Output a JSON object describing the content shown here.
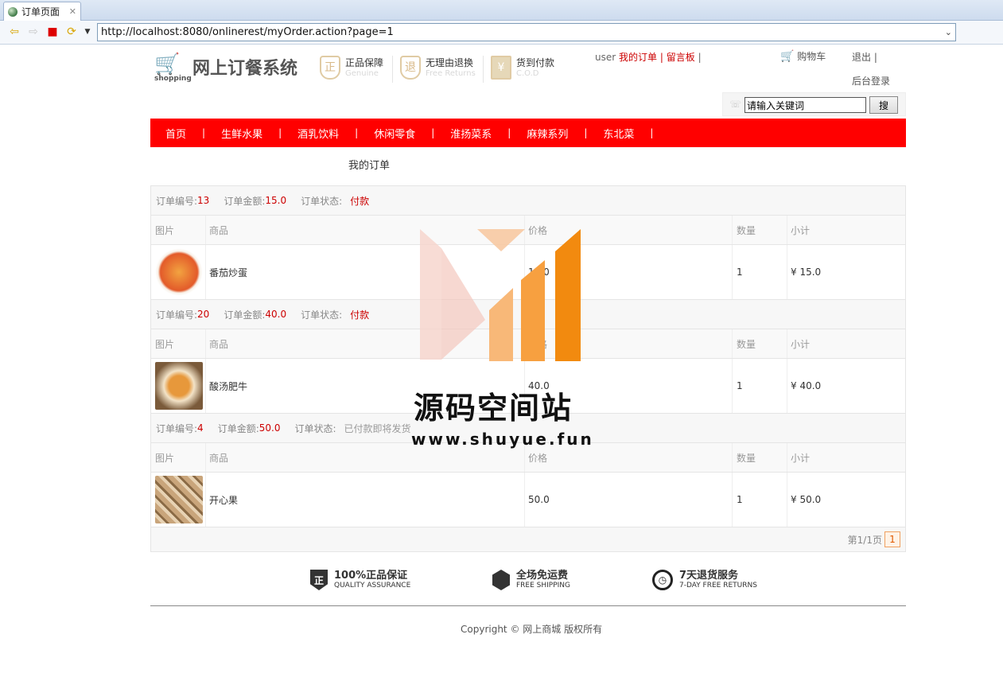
{
  "browser": {
    "tab_title": "订单页面",
    "url": "http://localhost:8080/onlinerest/myOrder.action?page=1"
  },
  "header": {
    "logo_sub": "shopping",
    "site_title": "网上订餐系统",
    "badges": [
      {
        "icon": "zheng-shield-icon",
        "glyph": "正",
        "title": "正品保障",
        "sub": "Genuine"
      },
      {
        "icon": "return-shield-icon",
        "glyph": "退",
        "title": "无理由退换",
        "sub": "Free Returns"
      },
      {
        "icon": "cod-icon",
        "glyph": "¥",
        "title": "货到付款",
        "sub": "C.O.D"
      }
    ],
    "user_label": "user",
    "my_orders": "我的订单",
    "sep": "|",
    "message_board": "留言板",
    "cart": "购物车",
    "logout": "退出",
    "admin_login": "后台登录",
    "search_placeholder": "请输入关键词",
    "search_button": "搜"
  },
  "menu": [
    "首页",
    "生鲜水果",
    "酒乳饮料",
    "休闲零食",
    "淮扬菜系",
    "麻辣系列",
    "东北菜"
  ],
  "page_title": "我的订单",
  "labels": {
    "order_no": "订单编号:",
    "amount": "订单金额:",
    "status": "订单状态:",
    "col_image": "图片",
    "col_goods": "商品",
    "col_price": "价格",
    "col_qty": "数量",
    "col_subtotal": "小计"
  },
  "orders": [
    {
      "no": "13",
      "amount": "15.0",
      "status": "付款",
      "item": "番茄炒蛋",
      "price": "15.0",
      "qty": "1",
      "subtotal": "¥ 15.0"
    },
    {
      "no": "20",
      "amount": "40.0",
      "status": "付款",
      "item": "酸汤肥牛",
      "price": "40.0",
      "qty": "1",
      "subtotal": "¥ 40.0"
    },
    {
      "no": "4",
      "amount": "50.0",
      "status": "已付款即将发货",
      "item": "开心果",
      "price": "50.0",
      "qty": "1",
      "subtotal": "¥ 50.0"
    }
  ],
  "pager": {
    "text": "第1/1页",
    "current": "1"
  },
  "services": [
    {
      "title": "100%正品保证",
      "sub": "QUALITY ASSURANCE"
    },
    {
      "title": "全场免运费",
      "sub": "FREE SHIPPING"
    },
    {
      "title": "7天退货服务",
      "sub": "7-DAY FREE RETURNS"
    }
  ],
  "copyright": "Copyright © 网上商城 版权所有",
  "watermark": {
    "title": "源码空间站",
    "url": "www.shuyue.fun"
  },
  "colors": {
    "accent": "#ff0000",
    "price_red": "#cc0000"
  }
}
